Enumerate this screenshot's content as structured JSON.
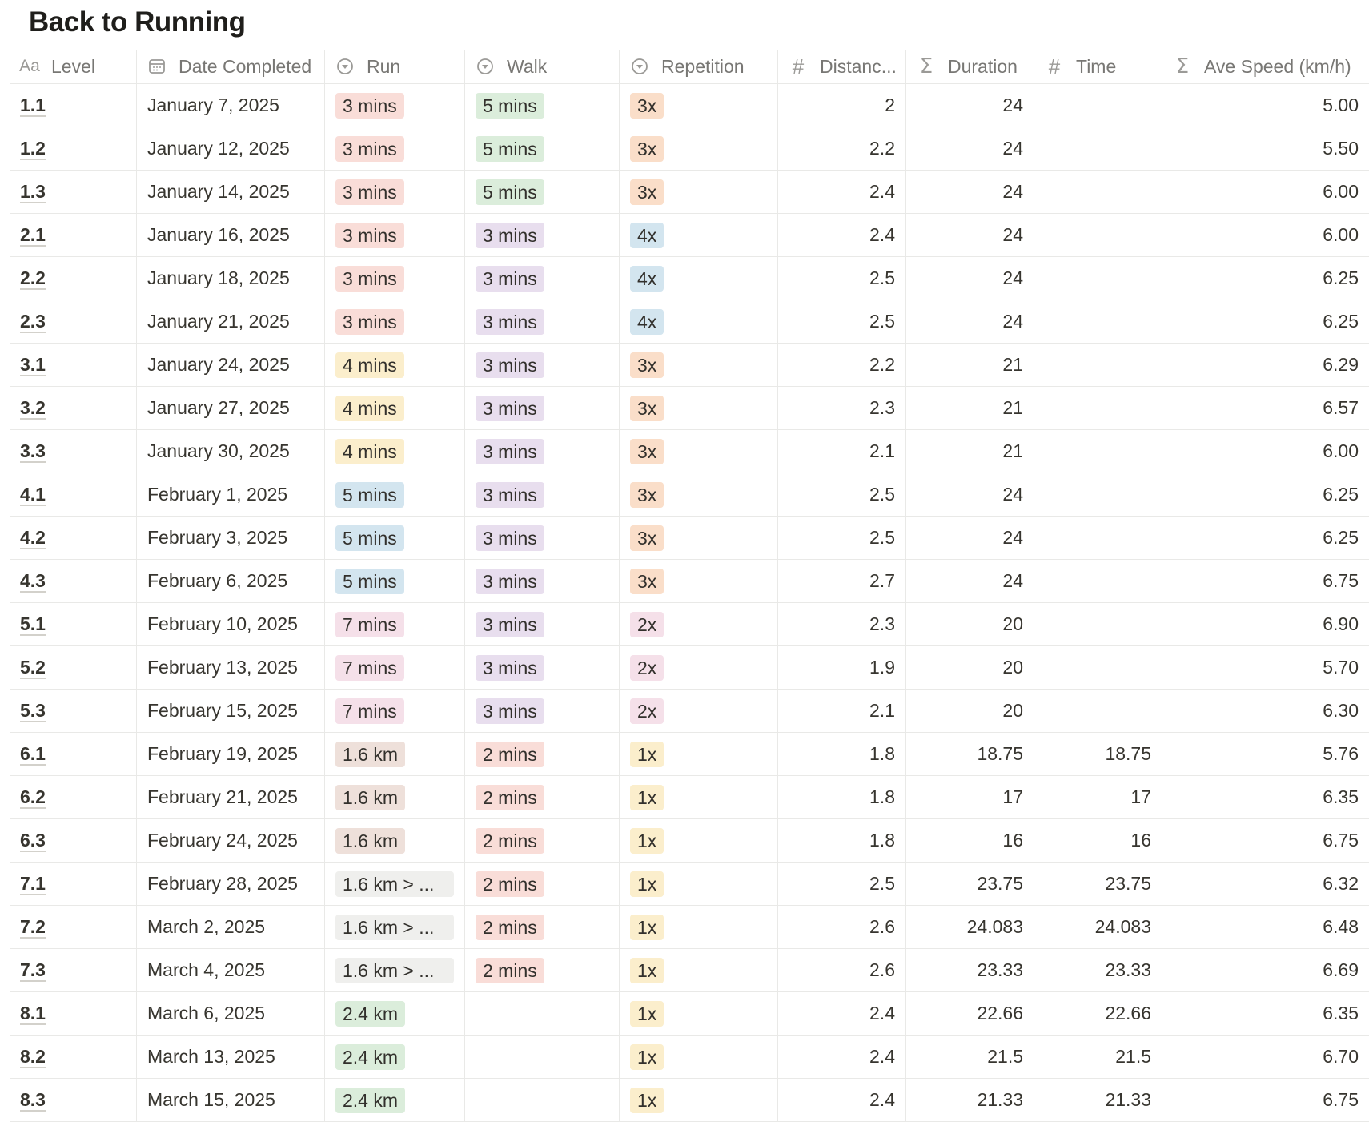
{
  "page": {
    "title": "Back to Running"
  },
  "colors": {
    "red": "#f9ddd8",
    "green": "#dbeddb",
    "purple": "#e8deee",
    "blue": "#d3e5ef",
    "orange": "#fadec9",
    "yellow": "#fbeecc",
    "pink": "#f5e0e9",
    "brown": "#eee0da",
    "gray": "#efefed"
  },
  "columns": [
    {
      "label": "Level",
      "icon": "text-type-icon"
    },
    {
      "label": "Date Completed",
      "icon": "calendar-icon"
    },
    {
      "label": "Run",
      "icon": "select-icon"
    },
    {
      "label": "Walk",
      "icon": "select-icon"
    },
    {
      "label": "Repetition",
      "icon": "select-icon"
    },
    {
      "label": "Distanc...",
      "icon": "number-hash-icon"
    },
    {
      "label": "Duration",
      "icon": "formula-sigma-icon"
    },
    {
      "label": "Time",
      "icon": "number-hash-icon"
    },
    {
      "label": "Ave Speed (km/h)",
      "icon": "formula-sigma-icon"
    }
  ],
  "rows": [
    {
      "level": "1.1",
      "date": "January 7, 2025",
      "run": "3 mins",
      "run_color": "red",
      "walk": "5 mins",
      "walk_color": "green",
      "rep": "3x",
      "rep_color": "orange",
      "distance": "2",
      "duration": "24",
      "time": "",
      "speed": "5.00"
    },
    {
      "level": "1.2",
      "date": "January 12, 2025",
      "run": "3 mins",
      "run_color": "red",
      "walk": "5 mins",
      "walk_color": "green",
      "rep": "3x",
      "rep_color": "orange",
      "distance": "2.2",
      "duration": "24",
      "time": "",
      "speed": "5.50"
    },
    {
      "level": "1.3",
      "date": "January 14, 2025",
      "run": "3 mins",
      "run_color": "red",
      "walk": "5 mins",
      "walk_color": "green",
      "rep": "3x",
      "rep_color": "orange",
      "distance": "2.4",
      "duration": "24",
      "time": "",
      "speed": "6.00"
    },
    {
      "level": "2.1",
      "date": "January 16, 2025",
      "run": "3 mins",
      "run_color": "red",
      "walk": "3 mins",
      "walk_color": "purple",
      "rep": "4x",
      "rep_color": "blue",
      "distance": "2.4",
      "duration": "24",
      "time": "",
      "speed": "6.00"
    },
    {
      "level": "2.2",
      "date": "January 18, 2025",
      "run": "3 mins",
      "run_color": "red",
      "walk": "3 mins",
      "walk_color": "purple",
      "rep": "4x",
      "rep_color": "blue",
      "distance": "2.5",
      "duration": "24",
      "time": "",
      "speed": "6.25"
    },
    {
      "level": "2.3",
      "date": "January 21, 2025",
      "run": "3 mins",
      "run_color": "red",
      "walk": "3 mins",
      "walk_color": "purple",
      "rep": "4x",
      "rep_color": "blue",
      "distance": "2.5",
      "duration": "24",
      "time": "",
      "speed": "6.25"
    },
    {
      "level": "3.1",
      "date": "January 24, 2025",
      "run": "4 mins",
      "run_color": "yellow",
      "walk": "3 mins",
      "walk_color": "purple",
      "rep": "3x",
      "rep_color": "orange",
      "distance": "2.2",
      "duration": "21",
      "time": "",
      "speed": "6.29"
    },
    {
      "level": "3.2",
      "date": "January 27, 2025",
      "run": "4 mins",
      "run_color": "yellow",
      "walk": "3 mins",
      "walk_color": "purple",
      "rep": "3x",
      "rep_color": "orange",
      "distance": "2.3",
      "duration": "21",
      "time": "",
      "speed": "6.57"
    },
    {
      "level": "3.3",
      "date": "January 30, 2025",
      "run": "4 mins",
      "run_color": "yellow",
      "walk": "3 mins",
      "walk_color": "purple",
      "rep": "3x",
      "rep_color": "orange",
      "distance": "2.1",
      "duration": "21",
      "time": "",
      "speed": "6.00"
    },
    {
      "level": "4.1",
      "date": "February 1, 2025",
      "run": "5 mins",
      "run_color": "blue",
      "walk": "3 mins",
      "walk_color": "purple",
      "rep": "3x",
      "rep_color": "orange",
      "distance": "2.5",
      "duration": "24",
      "time": "",
      "speed": "6.25"
    },
    {
      "level": "4.2",
      "date": "February 3, 2025",
      "run": "5 mins",
      "run_color": "blue",
      "walk": "3 mins",
      "walk_color": "purple",
      "rep": "3x",
      "rep_color": "orange",
      "distance": "2.5",
      "duration": "24",
      "time": "",
      "speed": "6.25"
    },
    {
      "level": "4.3",
      "date": "February 6, 2025",
      "run": "5 mins",
      "run_color": "blue",
      "walk": "3 mins",
      "walk_color": "purple",
      "rep": "3x",
      "rep_color": "orange",
      "distance": "2.7",
      "duration": "24",
      "time": "",
      "speed": "6.75"
    },
    {
      "level": "5.1",
      "date": "February 10, 2025",
      "run": "7 mins",
      "run_color": "pink",
      "walk": "3 mins",
      "walk_color": "purple",
      "rep": "2x",
      "rep_color": "pink",
      "distance": "2.3",
      "duration": "20",
      "time": "",
      "speed": "6.90"
    },
    {
      "level": "5.2",
      "date": "February 13, 2025",
      "run": "7 mins",
      "run_color": "pink",
      "walk": "3 mins",
      "walk_color": "purple",
      "rep": "2x",
      "rep_color": "pink",
      "distance": "1.9",
      "duration": "20",
      "time": "",
      "speed": "5.70"
    },
    {
      "level": "5.3",
      "date": "February 15, 2025",
      "run": "7 mins",
      "run_color": "pink",
      "walk": "3 mins",
      "walk_color": "purple",
      "rep": "2x",
      "rep_color": "pink",
      "distance": "2.1",
      "duration": "20",
      "time": "",
      "speed": "6.30"
    },
    {
      "level": "6.1",
      "date": "February 19, 2025",
      "run": "1.6 km",
      "run_color": "brown",
      "walk": "2 mins",
      "walk_color": "red",
      "rep": "1x",
      "rep_color": "yellow",
      "distance": "1.8",
      "duration": "18.75",
      "time": "18.75",
      "speed": "5.76"
    },
    {
      "level": "6.2",
      "date": "February 21, 2025",
      "run": "1.6 km",
      "run_color": "brown",
      "walk": "2 mins",
      "walk_color": "red",
      "rep": "1x",
      "rep_color": "yellow",
      "distance": "1.8",
      "duration": "17",
      "time": "17",
      "speed": "6.35"
    },
    {
      "level": "6.3",
      "date": "February 24, 2025",
      "run": "1.6 km",
      "run_color": "brown",
      "walk": "2 mins",
      "walk_color": "red",
      "rep": "1x",
      "rep_color": "yellow",
      "distance": "1.8",
      "duration": "16",
      "time": "16",
      "speed": "6.75"
    },
    {
      "level": "7.1",
      "date": "February 28, 2025",
      "run": "1.6 km > ...",
      "run_color": "gray",
      "walk": "2 mins",
      "walk_color": "red",
      "rep": "1x",
      "rep_color": "yellow",
      "distance": "2.5",
      "duration": "23.75",
      "time": "23.75",
      "speed": "6.32"
    },
    {
      "level": "7.2",
      "date": "March 2, 2025",
      "run": "1.6 km > ...",
      "run_color": "gray",
      "walk": "2 mins",
      "walk_color": "red",
      "rep": "1x",
      "rep_color": "yellow",
      "distance": "2.6",
      "duration": "24.083",
      "time": "24.083",
      "speed": "6.48"
    },
    {
      "level": "7.3",
      "date": "March 4, 2025",
      "run": "1.6 km > ...",
      "run_color": "gray",
      "walk": "2 mins",
      "walk_color": "red",
      "rep": "1x",
      "rep_color": "yellow",
      "distance": "2.6",
      "duration": "23.33",
      "time": "23.33",
      "speed": "6.69"
    },
    {
      "level": "8.1",
      "date": "March 6, 2025",
      "run": "2.4 km",
      "run_color": "green",
      "walk": "",
      "walk_color": "",
      "rep": "1x",
      "rep_color": "yellow",
      "distance": "2.4",
      "duration": "22.66",
      "time": "22.66",
      "speed": "6.35"
    },
    {
      "level": "8.2",
      "date": "March 13, 2025",
      "run": "2.4 km",
      "run_color": "green",
      "walk": "",
      "walk_color": "",
      "rep": "1x",
      "rep_color": "yellow",
      "distance": "2.4",
      "duration": "21.5",
      "time": "21.5",
      "speed": "6.70"
    },
    {
      "level": "8.3",
      "date": "March 15, 2025",
      "run": "2.4 km",
      "run_color": "green",
      "walk": "",
      "walk_color": "",
      "rep": "1x",
      "rep_color": "yellow",
      "distance": "2.4",
      "duration": "21.33",
      "time": "21.33",
      "speed": "6.75"
    }
  ]
}
